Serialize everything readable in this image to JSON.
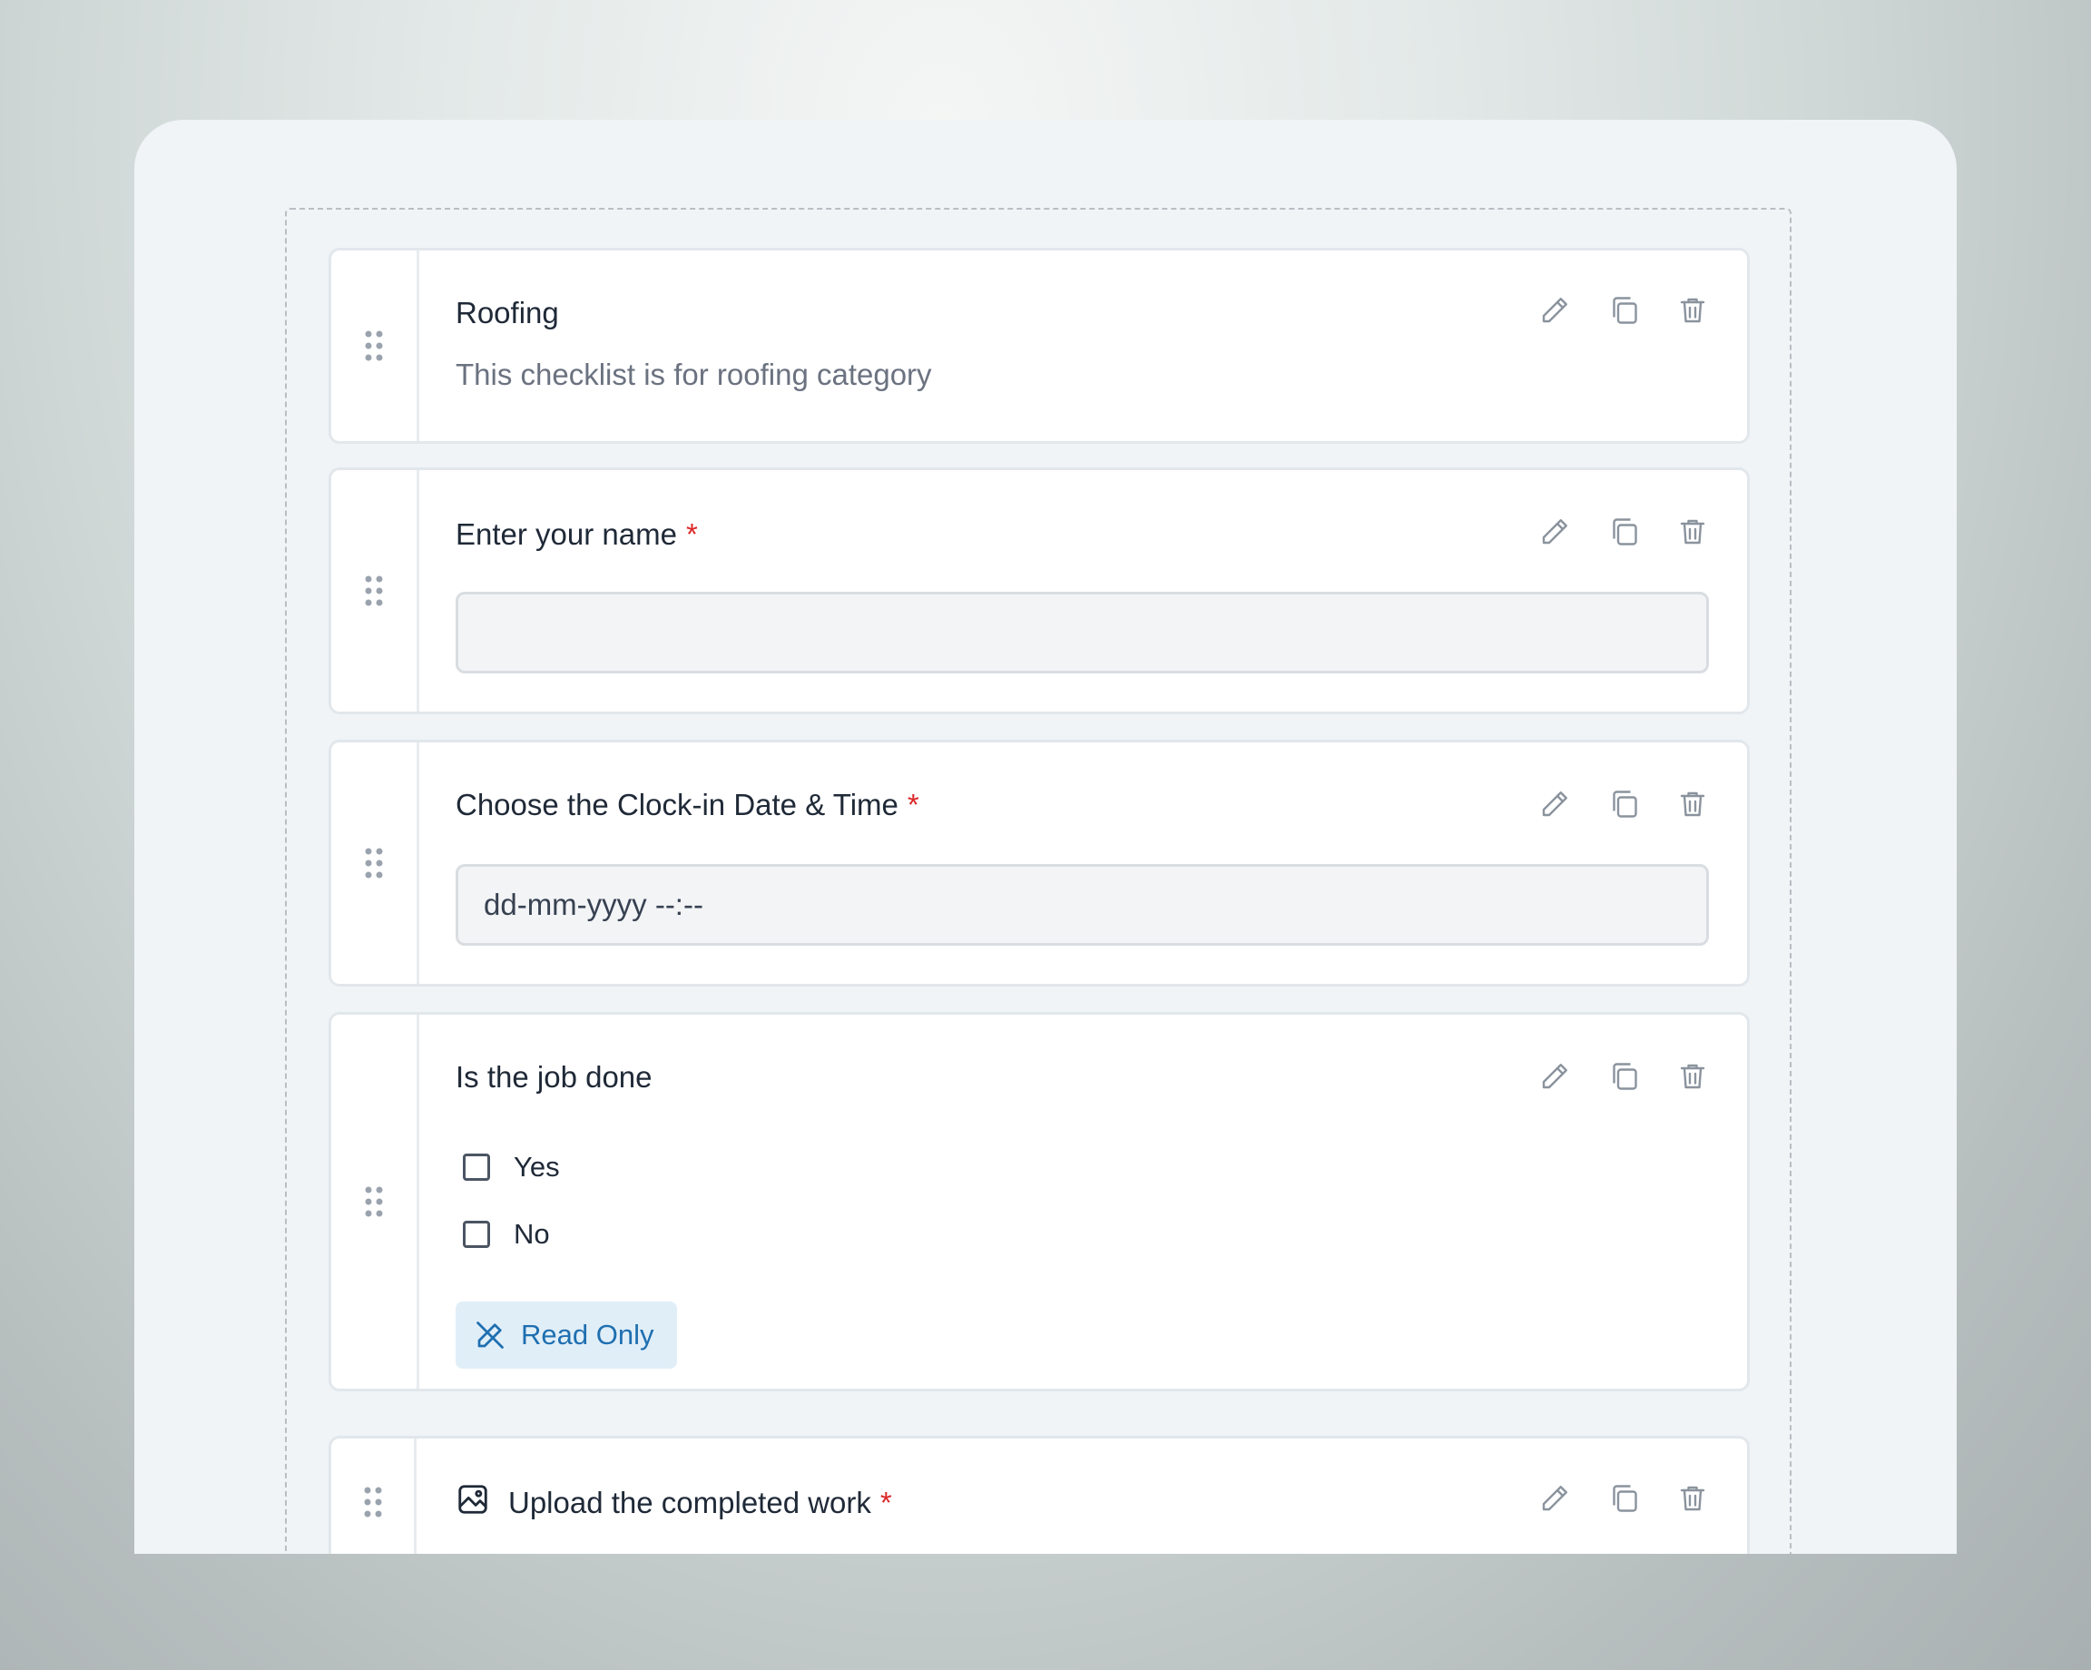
{
  "checklist": {
    "cards": [
      {
        "title": "Roofing",
        "subtitle": "This checklist is for roofing category"
      },
      {
        "title": "Enter your name",
        "required": "*",
        "input_value": ""
      },
      {
        "title": "Choose the Clock-in Date & Time",
        "required": "*",
        "placeholder": "dd-mm-yyyy --:--"
      },
      {
        "title": "Is the job done",
        "options": [
          "Yes",
          "No"
        ],
        "badge": "Read Only"
      },
      {
        "title": "Upload the completed work",
        "required": "*"
      }
    ]
  },
  "icons": {
    "drag": "drag-handle-icon",
    "edit": "pencil-icon",
    "duplicate": "copy-icon",
    "delete": "trash-icon",
    "readonly": "pencil-off-icon",
    "upload": "image-icon"
  },
  "colors": {
    "required": "#dc2626",
    "badge_bg": "#e0eef8",
    "badge_text": "#1f6fb0"
  }
}
